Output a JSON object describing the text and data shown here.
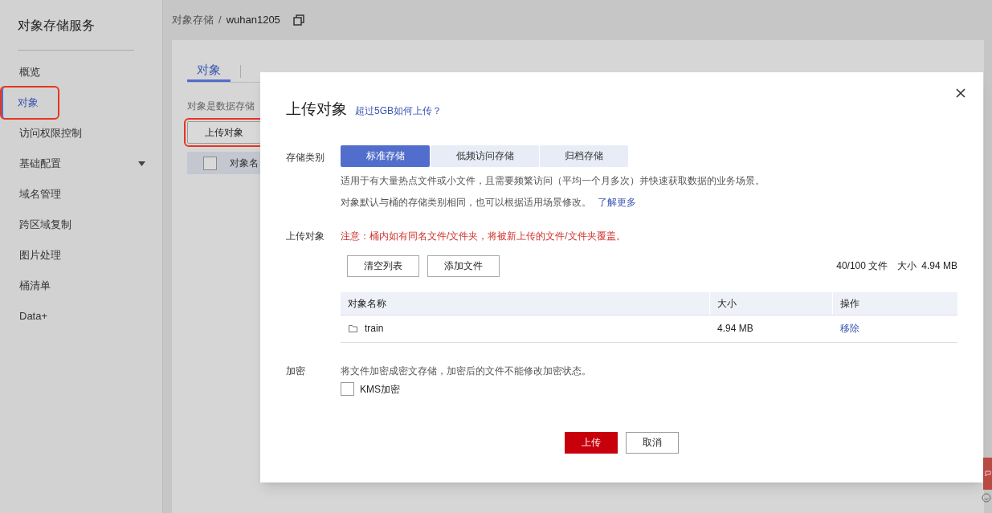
{
  "sidebar": {
    "title": "对象存储服务",
    "items": [
      {
        "label": "概览",
        "kind": "link",
        "selected": false,
        "highlighted": false
      },
      {
        "label": "对象",
        "kind": "link",
        "selected": true,
        "highlighted": true
      },
      {
        "label": "访问权限控制",
        "kind": "link",
        "selected": false,
        "highlighted": false
      },
      {
        "label": "基础配置",
        "kind": "group",
        "selected": false,
        "highlighted": false
      },
      {
        "label": "域名管理",
        "kind": "link",
        "selected": false,
        "highlighted": false
      },
      {
        "label": "跨区域复制",
        "kind": "link",
        "selected": false,
        "highlighted": false
      },
      {
        "label": "图片处理",
        "kind": "link",
        "selected": false,
        "highlighted": false
      },
      {
        "label": "桶清单",
        "kind": "link",
        "selected": false,
        "highlighted": false
      },
      {
        "label": "Data+",
        "kind": "link",
        "selected": false,
        "highlighted": false
      }
    ]
  },
  "breadcrumb": [
    "对象存储",
    "/",
    "wuhan1205"
  ],
  "tabs": [
    {
      "label": "对象",
      "selected": true
    }
  ],
  "description": "对象是数据存储",
  "upload_button": {
    "label": "上传对象",
    "highlighted": true
  },
  "object_table": {
    "select_all_checked": false,
    "column_1": "对象名"
  },
  "dialog": {
    "title": "上传对象",
    "help_link": "超过5GB如何上传？",
    "storage_class": {
      "label": "存储类别",
      "options": [
        {
          "label": "标准存储",
          "selected": true
        },
        {
          "label": "低频访问存储",
          "selected": false
        },
        {
          "label": "归档存储",
          "selected": false
        }
      ],
      "description": "适用于有大量热点文件或小文件，且需要频繁访问（平均一个月多次）并快速获取数据的业务场景。",
      "note": "对象默认与桶的存储类别相同，也可以根据适用场景修改。",
      "note_link": "了解更多"
    },
    "upload": {
      "label": "上传对象",
      "warning": "注意：桶内如有同名文件/文件夹，将被新上传的文件/文件夹覆盖。",
      "buttons": [
        "清空列表",
        "添加文件"
      ],
      "count": "40/100 文件",
      "size_label": "大小",
      "size": "4.94 MB",
      "columns": [
        "对象名称",
        "大小",
        "操作"
      ],
      "rows": [
        {
          "kind": "folder",
          "name": "train",
          "size": "4.94 MB",
          "action": "移除"
        }
      ]
    },
    "encryption": {
      "label": "加密",
      "description": "将文件加密成密文存储，加密后的文件不能修改加密状态。",
      "checkbox": {
        "label": "KMS加密",
        "checked": false
      }
    },
    "footer": [
      {
        "label": "上传",
        "kind": "primary"
      },
      {
        "label": "取消",
        "kind": "secondary"
      }
    ]
  }
}
